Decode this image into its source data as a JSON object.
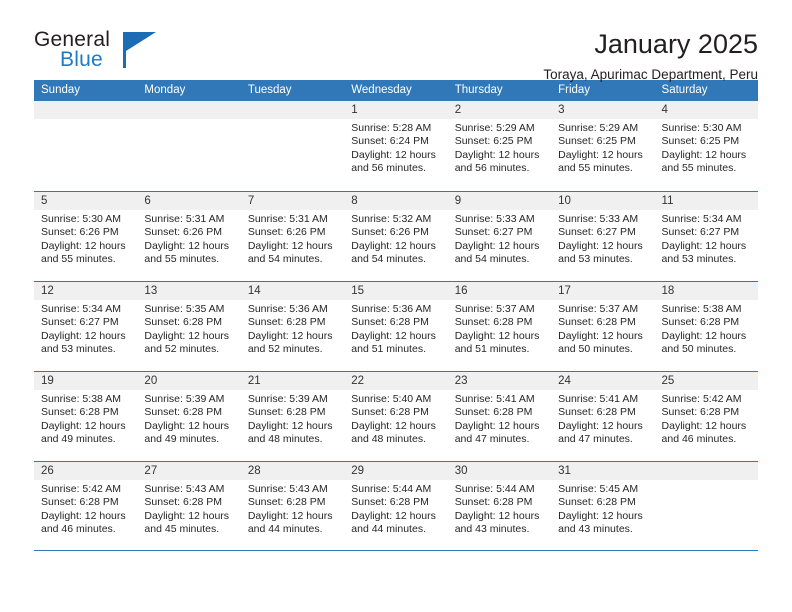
{
  "brand": {
    "name_part1": "General",
    "name_part2": "Blue",
    "triangle_icon": "triangle-icon",
    "accent_color": "#1b6cb5"
  },
  "header": {
    "title": "January 2025",
    "subtitle": "Toraya, Apurimac Department, Peru"
  },
  "calendar": {
    "header_bg": "#3178b8",
    "day_strip_bg": "#f0f0f0",
    "weekdays": [
      "Sunday",
      "Monday",
      "Tuesday",
      "Wednesday",
      "Thursday",
      "Friday",
      "Saturday"
    ],
    "weeks": [
      [
        {
          "empty": true
        },
        {
          "empty": true
        },
        {
          "empty": true
        },
        {
          "day": "1",
          "sunrise": "Sunrise: 5:28 AM",
          "sunset": "Sunset: 6:24 PM",
          "daylight_1": "Daylight: 12 hours",
          "daylight_2": "and 56 minutes."
        },
        {
          "day": "2",
          "sunrise": "Sunrise: 5:29 AM",
          "sunset": "Sunset: 6:25 PM",
          "daylight_1": "Daylight: 12 hours",
          "daylight_2": "and 56 minutes."
        },
        {
          "day": "3",
          "sunrise": "Sunrise: 5:29 AM",
          "sunset": "Sunset: 6:25 PM",
          "daylight_1": "Daylight: 12 hours",
          "daylight_2": "and 55 minutes."
        },
        {
          "day": "4",
          "sunrise": "Sunrise: 5:30 AM",
          "sunset": "Sunset: 6:25 PM",
          "daylight_1": "Daylight: 12 hours",
          "daylight_2": "and 55 minutes."
        }
      ],
      [
        {
          "day": "5",
          "sunrise": "Sunrise: 5:30 AM",
          "sunset": "Sunset: 6:26 PM",
          "daylight_1": "Daylight: 12 hours",
          "daylight_2": "and 55 minutes."
        },
        {
          "day": "6",
          "sunrise": "Sunrise: 5:31 AM",
          "sunset": "Sunset: 6:26 PM",
          "daylight_1": "Daylight: 12 hours",
          "daylight_2": "and 55 minutes."
        },
        {
          "day": "7",
          "sunrise": "Sunrise: 5:31 AM",
          "sunset": "Sunset: 6:26 PM",
          "daylight_1": "Daylight: 12 hours",
          "daylight_2": "and 54 minutes."
        },
        {
          "day": "8",
          "sunrise": "Sunrise: 5:32 AM",
          "sunset": "Sunset: 6:26 PM",
          "daylight_1": "Daylight: 12 hours",
          "daylight_2": "and 54 minutes."
        },
        {
          "day": "9",
          "sunrise": "Sunrise: 5:33 AM",
          "sunset": "Sunset: 6:27 PM",
          "daylight_1": "Daylight: 12 hours",
          "daylight_2": "and 54 minutes."
        },
        {
          "day": "10",
          "sunrise": "Sunrise: 5:33 AM",
          "sunset": "Sunset: 6:27 PM",
          "daylight_1": "Daylight: 12 hours",
          "daylight_2": "and 53 minutes."
        },
        {
          "day": "11",
          "sunrise": "Sunrise: 5:34 AM",
          "sunset": "Sunset: 6:27 PM",
          "daylight_1": "Daylight: 12 hours",
          "daylight_2": "and 53 minutes."
        }
      ],
      [
        {
          "day": "12",
          "sunrise": "Sunrise: 5:34 AM",
          "sunset": "Sunset: 6:27 PM",
          "daylight_1": "Daylight: 12 hours",
          "daylight_2": "and 53 minutes."
        },
        {
          "day": "13",
          "sunrise": "Sunrise: 5:35 AM",
          "sunset": "Sunset: 6:28 PM",
          "daylight_1": "Daylight: 12 hours",
          "daylight_2": "and 52 minutes."
        },
        {
          "day": "14",
          "sunrise": "Sunrise: 5:36 AM",
          "sunset": "Sunset: 6:28 PM",
          "daylight_1": "Daylight: 12 hours",
          "daylight_2": "and 52 minutes."
        },
        {
          "day": "15",
          "sunrise": "Sunrise: 5:36 AM",
          "sunset": "Sunset: 6:28 PM",
          "daylight_1": "Daylight: 12 hours",
          "daylight_2": "and 51 minutes."
        },
        {
          "day": "16",
          "sunrise": "Sunrise: 5:37 AM",
          "sunset": "Sunset: 6:28 PM",
          "daylight_1": "Daylight: 12 hours",
          "daylight_2": "and 51 minutes."
        },
        {
          "day": "17",
          "sunrise": "Sunrise: 5:37 AM",
          "sunset": "Sunset: 6:28 PM",
          "daylight_1": "Daylight: 12 hours",
          "daylight_2": "and 50 minutes."
        },
        {
          "day": "18",
          "sunrise": "Sunrise: 5:38 AM",
          "sunset": "Sunset: 6:28 PM",
          "daylight_1": "Daylight: 12 hours",
          "daylight_2": "and 50 minutes."
        }
      ],
      [
        {
          "day": "19",
          "sunrise": "Sunrise: 5:38 AM",
          "sunset": "Sunset: 6:28 PM",
          "daylight_1": "Daylight: 12 hours",
          "daylight_2": "and 49 minutes."
        },
        {
          "day": "20",
          "sunrise": "Sunrise: 5:39 AM",
          "sunset": "Sunset: 6:28 PM",
          "daylight_1": "Daylight: 12 hours",
          "daylight_2": "and 49 minutes."
        },
        {
          "day": "21",
          "sunrise": "Sunrise: 5:39 AM",
          "sunset": "Sunset: 6:28 PM",
          "daylight_1": "Daylight: 12 hours",
          "daylight_2": "and 48 minutes."
        },
        {
          "day": "22",
          "sunrise": "Sunrise: 5:40 AM",
          "sunset": "Sunset: 6:28 PM",
          "daylight_1": "Daylight: 12 hours",
          "daylight_2": "and 48 minutes."
        },
        {
          "day": "23",
          "sunrise": "Sunrise: 5:41 AM",
          "sunset": "Sunset: 6:28 PM",
          "daylight_1": "Daylight: 12 hours",
          "daylight_2": "and 47 minutes."
        },
        {
          "day": "24",
          "sunrise": "Sunrise: 5:41 AM",
          "sunset": "Sunset: 6:28 PM",
          "daylight_1": "Daylight: 12 hours",
          "daylight_2": "and 47 minutes."
        },
        {
          "day": "25",
          "sunrise": "Sunrise: 5:42 AM",
          "sunset": "Sunset: 6:28 PM",
          "daylight_1": "Daylight: 12 hours",
          "daylight_2": "and 46 minutes."
        }
      ],
      [
        {
          "day": "26",
          "sunrise": "Sunrise: 5:42 AM",
          "sunset": "Sunset: 6:28 PM",
          "daylight_1": "Daylight: 12 hours",
          "daylight_2": "and 46 minutes."
        },
        {
          "day": "27",
          "sunrise": "Sunrise: 5:43 AM",
          "sunset": "Sunset: 6:28 PM",
          "daylight_1": "Daylight: 12 hours",
          "daylight_2": "and 45 minutes."
        },
        {
          "day": "28",
          "sunrise": "Sunrise: 5:43 AM",
          "sunset": "Sunset: 6:28 PM",
          "daylight_1": "Daylight: 12 hours",
          "daylight_2": "and 44 minutes."
        },
        {
          "day": "29",
          "sunrise": "Sunrise: 5:44 AM",
          "sunset": "Sunset: 6:28 PM",
          "daylight_1": "Daylight: 12 hours",
          "daylight_2": "and 44 minutes."
        },
        {
          "day": "30",
          "sunrise": "Sunrise: 5:44 AM",
          "sunset": "Sunset: 6:28 PM",
          "daylight_1": "Daylight: 12 hours",
          "daylight_2": "and 43 minutes."
        },
        {
          "day": "31",
          "sunrise": "Sunrise: 5:45 AM",
          "sunset": "Sunset: 6:28 PM",
          "daylight_1": "Daylight: 12 hours",
          "daylight_2": "and 43 minutes."
        },
        {
          "empty": true
        }
      ]
    ]
  }
}
